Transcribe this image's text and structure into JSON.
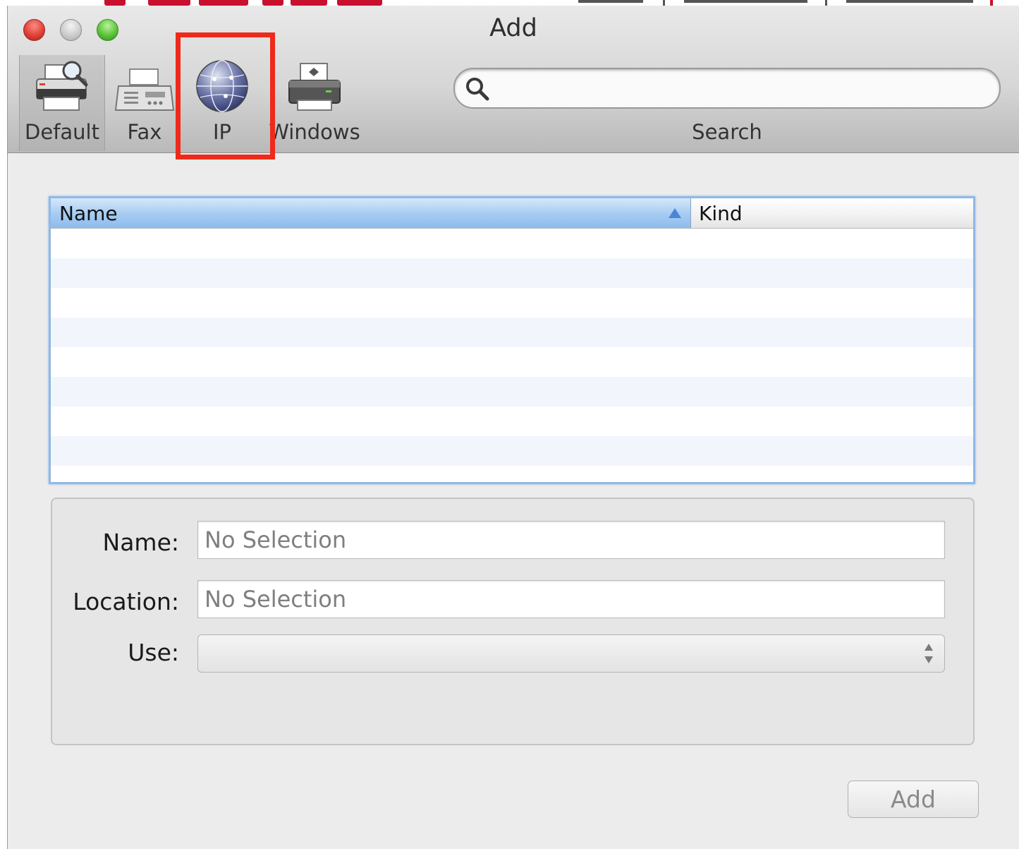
{
  "window": {
    "title": "Add"
  },
  "toolbar": {
    "items": [
      {
        "label": "Default",
        "icon": "default-printer-icon",
        "selected": true
      },
      {
        "label": "Fax",
        "icon": "fax-icon",
        "selected": false
      },
      {
        "label": "IP",
        "icon": "ip-globe-icon",
        "selected": false,
        "highlighted": true
      },
      {
        "label": "Windows",
        "icon": "windows-printer-icon",
        "selected": false
      }
    ],
    "search": {
      "label": "Search",
      "value": "",
      "icon": "search-icon"
    }
  },
  "table": {
    "columns": [
      {
        "label": "Name",
        "sorted": "ascending"
      },
      {
        "label": "Kind"
      }
    ],
    "rows": []
  },
  "details": {
    "name_label": "Name:",
    "name_placeholder": "No Selection",
    "location_label": "Location:",
    "location_placeholder": "No Selection",
    "use_label": "Use:",
    "use_value": ""
  },
  "actions": {
    "add_label": "Add"
  },
  "colors": {
    "highlight": "#ee2a1b",
    "table_focus": "#8fb8e6",
    "header_selected": "#a8cdf2"
  }
}
